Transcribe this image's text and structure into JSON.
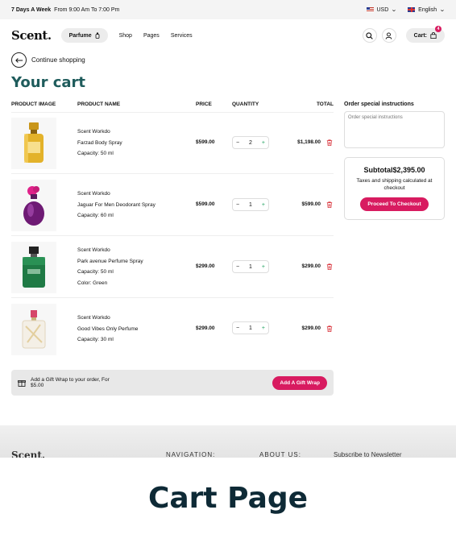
{
  "topbar": {
    "hours_bold": "7 Days A Week",
    "hours_rest": "From 9:00 Am To 7:00 Pm",
    "currency": "USD",
    "language": "English"
  },
  "header": {
    "logo": "Scent.",
    "category_pill": "Parfume",
    "nav": [
      "Shop",
      "Pages",
      "Services"
    ],
    "cart_label": "Cart:",
    "cart_count": "4"
  },
  "continue_label": "Continue shopping",
  "page_title": "Your cart",
  "table": {
    "headers": {
      "image": "PRODUCT IMAGE",
      "name": "PRODUCT NAME",
      "price": "PRICE",
      "quantity": "QUANTITY",
      "total": "TOTAL"
    },
    "rows": [
      {
        "brand": "Scent Workdo",
        "name": "Farzad Body Spray",
        "attrs": [
          "Capacity: 50 ml"
        ],
        "price": "$599.00",
        "qty": "2",
        "total": "$1,198.00",
        "bottle": "gold"
      },
      {
        "brand": "Scent Workdo",
        "name": "Jaguar For Men Deodorant Spray",
        "attrs": [
          "Capacity: 60 ml"
        ],
        "price": "$599.00",
        "qty": "1",
        "total": "$599.00",
        "bottle": "purple"
      },
      {
        "brand": "Scent Workdo",
        "name": "Park avenue Perfume Spray",
        "attrs": [
          "Capacity: 50 ml",
          "Color: Green"
        ],
        "price": "$299.00",
        "qty": "1",
        "total": "$299.00",
        "bottle": "green"
      },
      {
        "brand": "Scent Workdo",
        "name": "Good Vibes Only Perfume",
        "attrs": [
          "Capacity: 30 ml"
        ],
        "price": "$299.00",
        "qty": "1",
        "total": "$299.00",
        "bottle": "clear"
      }
    ]
  },
  "gift": {
    "text_line1": "Add a Gift Wrap to your order, For",
    "text_line2": "$5.00",
    "button": "Add A Gift Wrap"
  },
  "sidebar": {
    "instructions_label": "Order special instructions",
    "instructions_placeholder": "Order special instructions",
    "subtotal_label": "Subtotal",
    "subtotal_value": "$2,395.00",
    "tax_note": "Taxes and shipping calculated at checkout",
    "checkout_button": "Proceed To Checkout"
  },
  "footer": {
    "brand": "Scent.",
    "col1": "NAVIGATION:",
    "col2": "ABOUT US:",
    "col3": "Subscribe to Newsletter"
  },
  "caption": "Cart Page",
  "colors": {
    "accent": "#d81b60",
    "title": "#1f5c5c"
  }
}
